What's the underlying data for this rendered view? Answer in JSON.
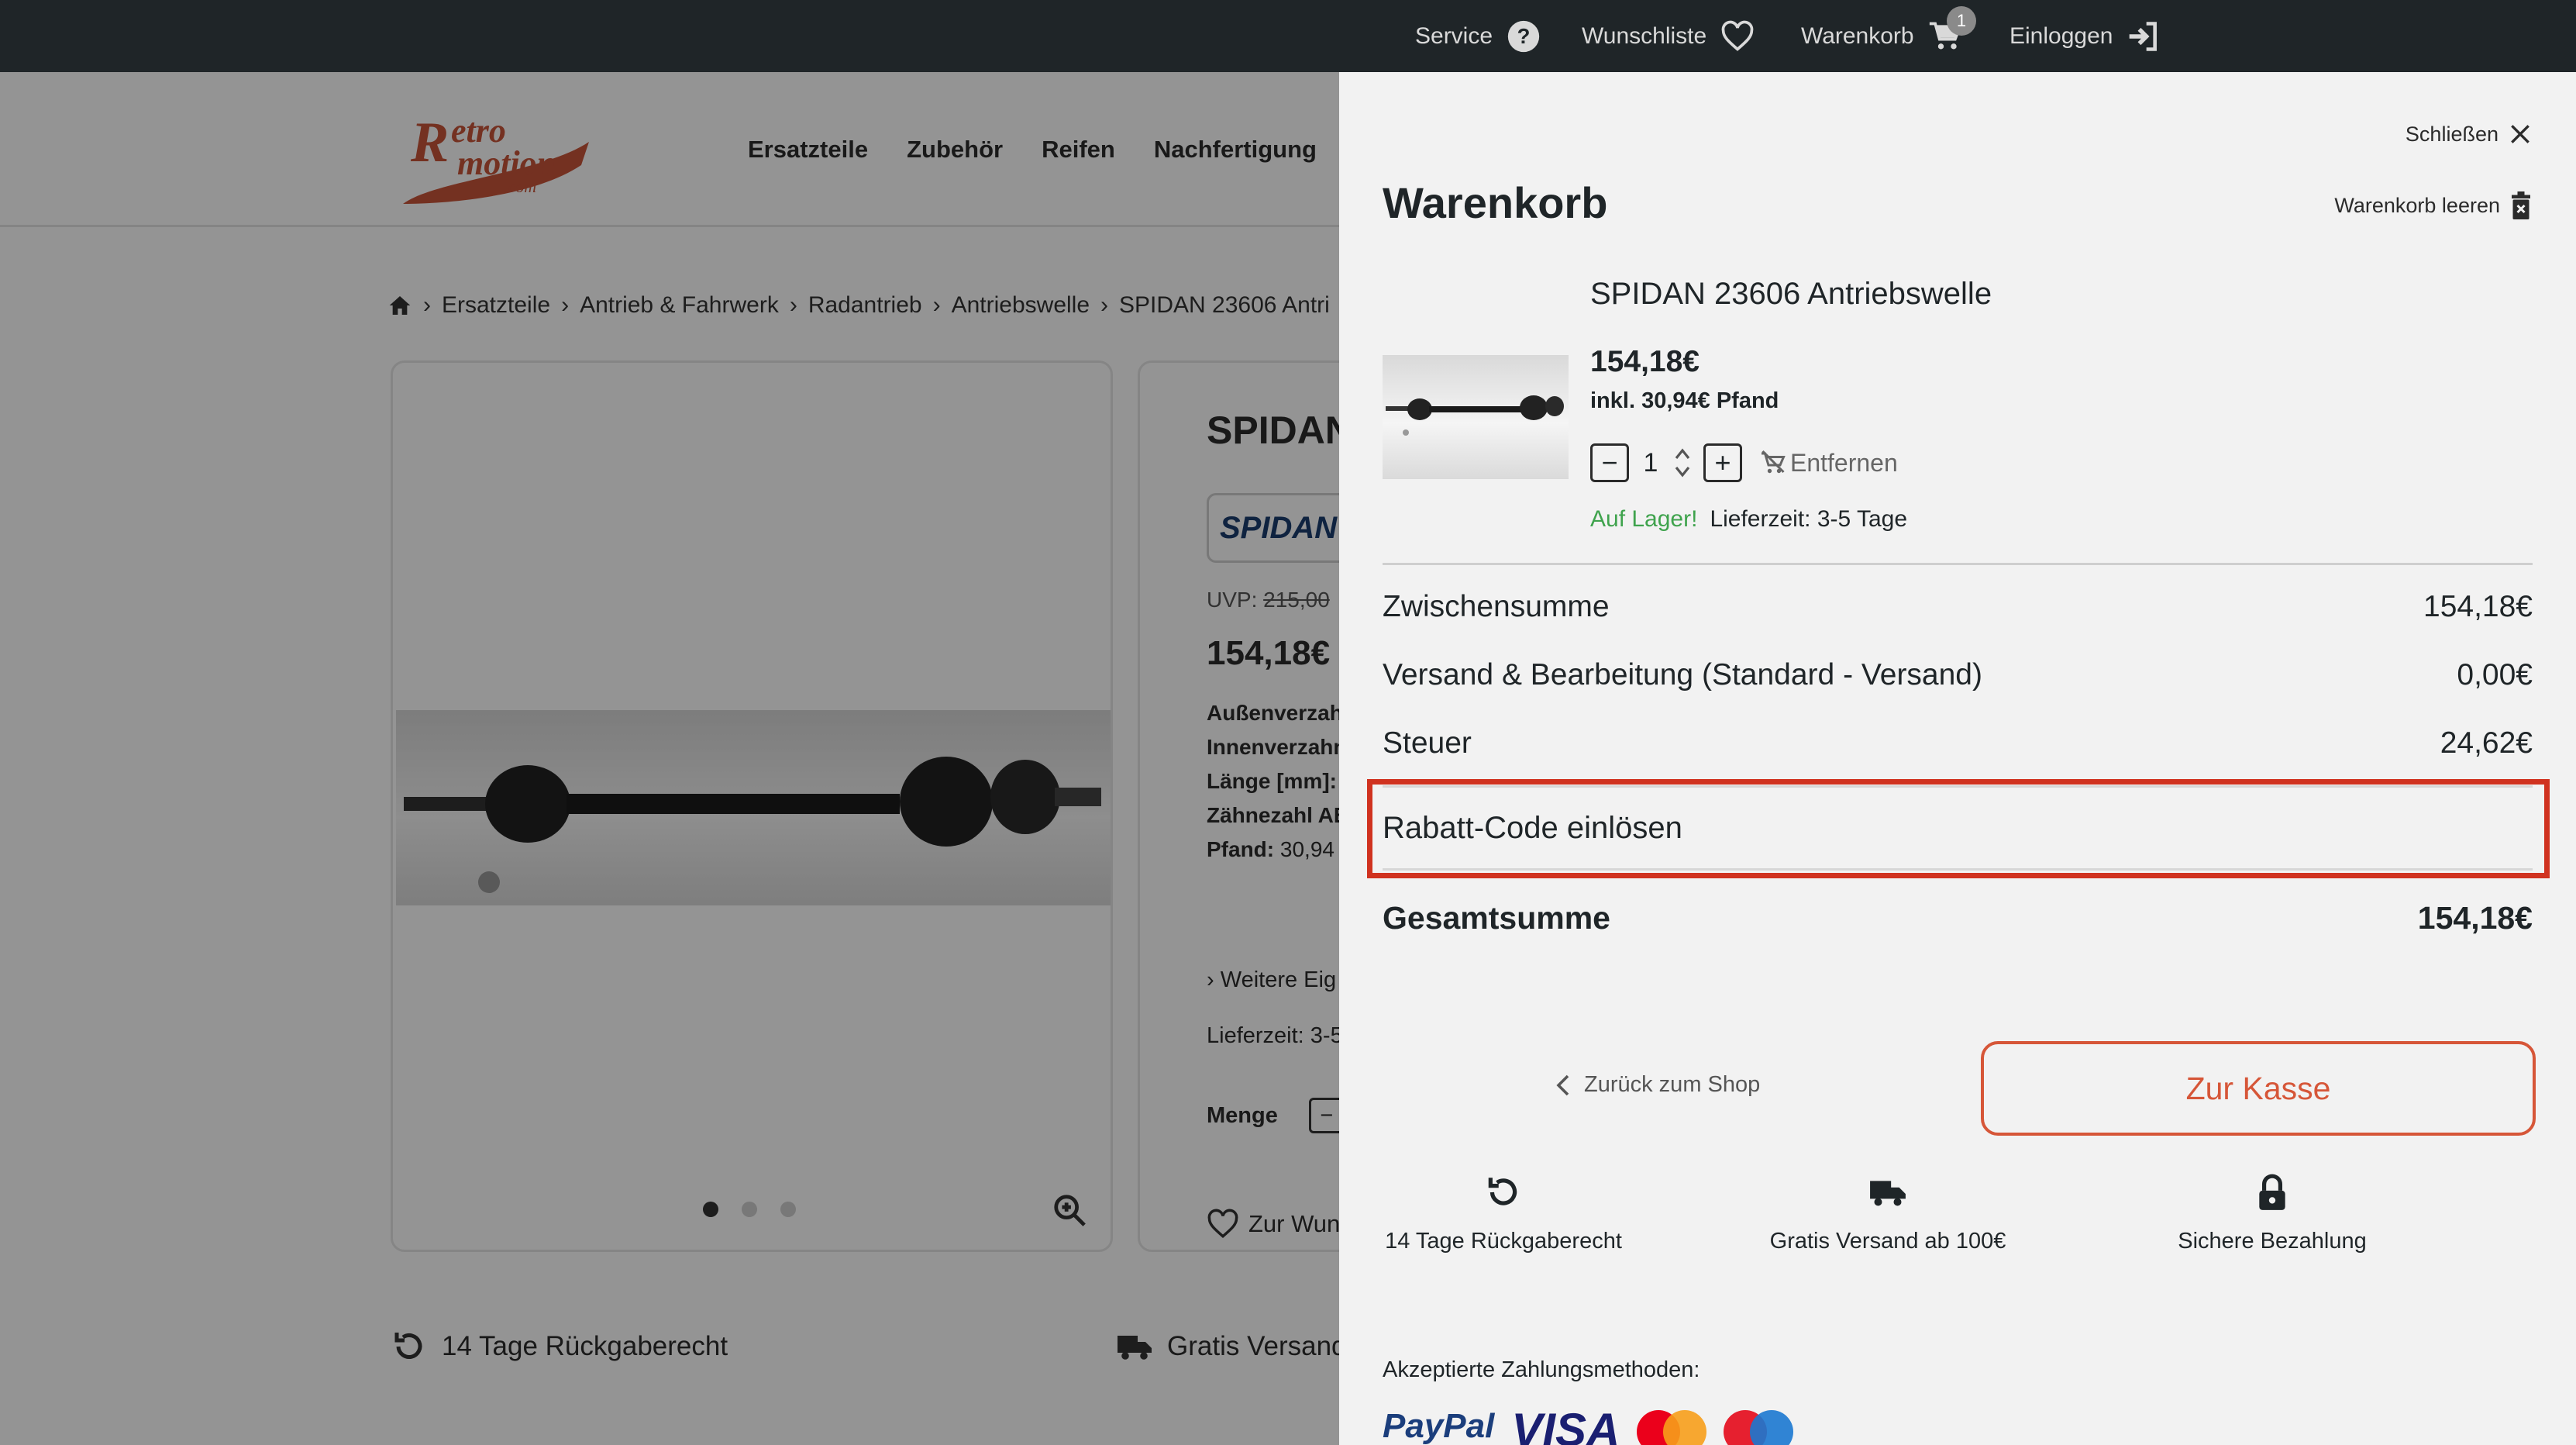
{
  "topbar": {
    "service": "Service",
    "wishlist": "Wunschliste",
    "cart": "Warenkorb",
    "cart_count": "1",
    "login": "Einloggen"
  },
  "background": {
    "logo_text": "Retro motion .com",
    "nav": [
      "Ersatzteile",
      "Zubehör",
      "Reifen",
      "Nachfertigung"
    ],
    "breadcrumb": [
      "Ersatzteile",
      "Antrieb & Fahrwerk",
      "Radantrieb",
      "Antriebswelle",
      "SPIDAN 23606 Antri"
    ],
    "product_title": "SPIDAN",
    "brand": "SPIDAN",
    "uvp_label": "UVP:",
    "uvp_value": "215,00",
    "price": "154,18€",
    "specs": [
      {
        "label": "Außenverzah",
        "value": ""
      },
      {
        "label": "Innenverzahn",
        "value": ""
      },
      {
        "label": "Länge [mm]:",
        "value": ""
      },
      {
        "label": "Zähnezahl AB",
        "value": ""
      },
      {
        "label": "Pfand:",
        "value": "30,94"
      }
    ],
    "more": "Weitere Eig",
    "delivery": "Lieferzeit: 3-5",
    "quantity_label": "Menge",
    "wishlist_btn": "Zur Wun",
    "usp_return": "14 Tage Rückgaberecht",
    "usp_shipping": "Gratis Versand"
  },
  "drawer": {
    "close": "Schließen",
    "title": "Warenkorb",
    "clear": "Warenkorb leeren",
    "item": {
      "name": "SPIDAN 23606 Antriebswelle",
      "price": "154,18€",
      "deposit": "inkl. 30,94€ Pfand",
      "quantity": "1",
      "remove": "Entfernen",
      "in_stock": "Auf Lager!",
      "delivery": "Lieferzeit: 3-5 Tage"
    },
    "subtotal_label": "Zwischensumme",
    "subtotal_value": "154,18€",
    "shipping_label": "Versand & Bearbeitung (Standard - Versand)",
    "shipping_value": "0,00€",
    "tax_label": "Steuer",
    "tax_value": "24,62€",
    "coupon": "Rabatt-Code einlösen",
    "total_label": "Gesamtsumme",
    "total_value": "154,18€",
    "back": "Zurück zum Shop",
    "checkout": "Zur Kasse",
    "usps": [
      "14 Tage Rückgaberecht",
      "Gratis Versand ab 100€",
      "Sichere Bezahlung"
    ],
    "payments_label": "Akzeptierte Zahlungsmethoden:",
    "payment_methods": [
      "PayPal",
      "VISA",
      "Mastercard",
      "Maestro"
    ]
  },
  "colors": {
    "topbar": "#1f2528",
    "accent": "#d65638",
    "highlight": "#d0321f",
    "in_stock": "#3fa34d",
    "drawer_bg": "#f2f2f2"
  }
}
